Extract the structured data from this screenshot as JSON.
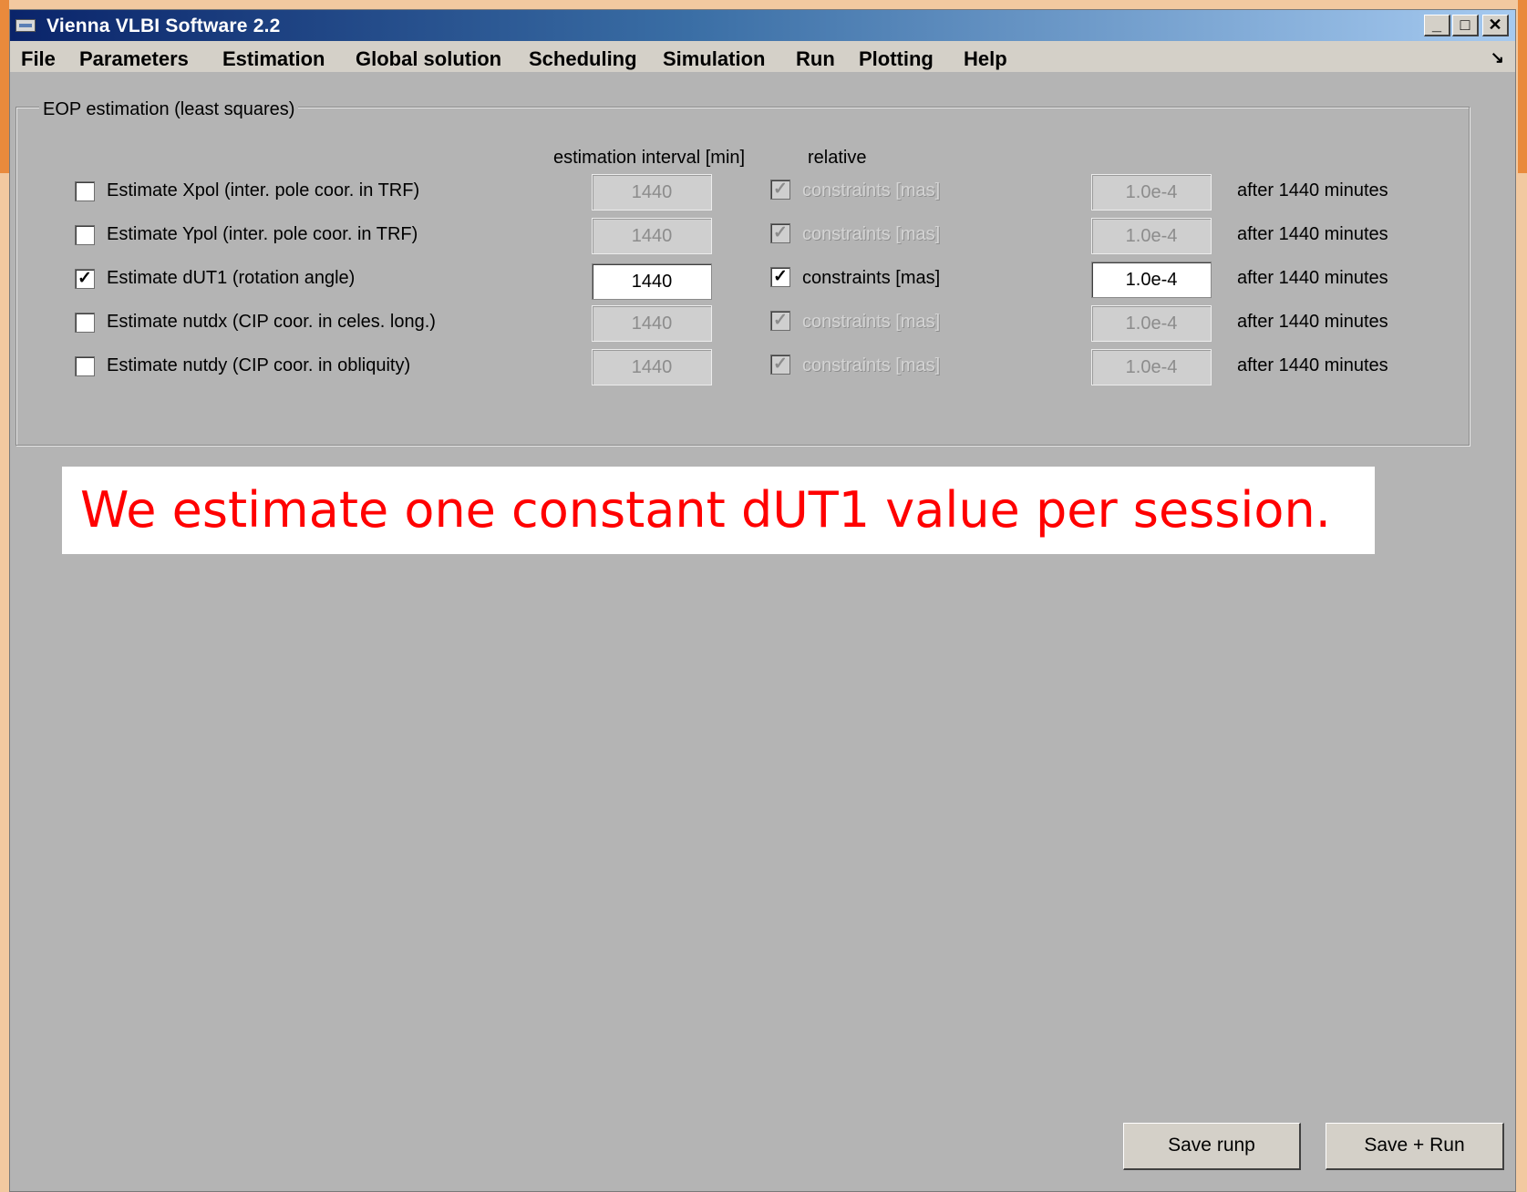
{
  "window": {
    "title": "Vienna VLBI Software 2.2",
    "controls": {
      "minimize": "_",
      "maximize": "□",
      "close": "✕"
    }
  },
  "menu": {
    "items": [
      "File",
      "Parameters",
      "Estimation",
      "Global solution",
      "Scheduling",
      "Simulation",
      "Run",
      "Plotting",
      "Help"
    ],
    "resize_glyph": "↘"
  },
  "group": {
    "title": "EOP estimation (least squares)",
    "col_interval": "estimation interval [min]",
    "col_relative": "relative"
  },
  "rows": [
    {
      "checked": false,
      "label": "Estimate Xpol (inter. pole coor. in TRF)",
      "interval": "1440",
      "constraints_checked": true,
      "constraints_label": "constraints [mas]",
      "constraint_value": "1.0e-4",
      "after": "after 1440 minutes",
      "enabled": false
    },
    {
      "checked": false,
      "label": "Estimate Ypol (inter. pole coor. in TRF)",
      "interval": "1440",
      "constraints_checked": true,
      "constraints_label": "constraints [mas]",
      "constraint_value": "1.0e-4",
      "after": "after 1440 minutes",
      "enabled": false
    },
    {
      "checked": true,
      "label": "Estimate dUT1 (rotation angle)",
      "interval": "1440",
      "constraints_checked": true,
      "constraints_label": "constraints [mas]",
      "constraint_value": "1.0e-4",
      "after": "after 1440 minutes",
      "enabled": true
    },
    {
      "checked": false,
      "label": "Estimate nutdx (CIP coor. in celes. long.)",
      "interval": "1440",
      "constraints_checked": true,
      "constraints_label": "constraints [mas]",
      "constraint_value": "1.0e-4",
      "after": "after 1440 minutes",
      "enabled": false
    },
    {
      "checked": false,
      "label": "Estimate nutdy (CIP coor. in obliquity)",
      "interval": "1440",
      "constraints_checked": true,
      "constraints_label": "constraints [mas]",
      "constraint_value": "1.0e-4",
      "after": "after 1440 minutes",
      "enabled": false
    }
  ],
  "note": {
    "text": "We estimate one constant dUT1 value per session.",
    "color": "#ff0000"
  },
  "buttons": {
    "save_runp": "Save runp",
    "save_run": "Save + Run"
  },
  "colors": {
    "accent": "#0a246a",
    "window_bg": "#b4b4b4",
    "slide_border": "#e98a3c"
  }
}
